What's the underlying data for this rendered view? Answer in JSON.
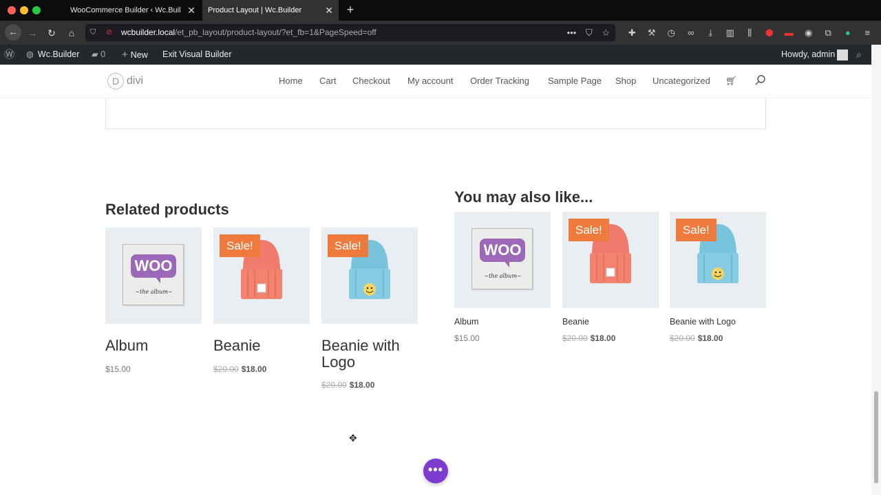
{
  "browser": {
    "tabs": [
      {
        "label": "WooCommerce Builder ‹ Wc.Builder"
      },
      {
        "label": "Product Layout | Wc.Builder"
      }
    ],
    "url_host": "wcbuilder.local",
    "url_path": "/et_pb_layout/product-layout/?et_fb=1&PageSpeed=off"
  },
  "adminbar": {
    "site_name": "Wc.Builder",
    "comments_count": "0",
    "new_label": "New",
    "exit_label": "Exit Visual Builder",
    "howdy": "Howdy, admin"
  },
  "header": {
    "logo_text": "divi",
    "logo_letter": "D",
    "menu": [
      "Home",
      "Cart",
      "Checkout",
      "My account",
      "Order Tracking",
      "Sample Page",
      "Shop",
      "Uncategorized"
    ]
  },
  "related": {
    "title": "Related products",
    "products": [
      {
        "name": "Album",
        "price": "$15.00"
      },
      {
        "name": "Beanie",
        "sale": "Sale!",
        "old_price": "$20.00",
        "price": "$18.00"
      },
      {
        "name": "Beanie with Logo",
        "sale": "Sale!",
        "old_price": "$20.00",
        "price": "$18.00"
      }
    ]
  },
  "also_like": {
    "title": "You may also like...",
    "products": [
      {
        "name": "Album",
        "price": "$15.00"
      },
      {
        "name": "Beanie",
        "sale": "Sale!",
        "old_price": "$20.00",
        "price": "$18.00"
      },
      {
        "name": "Beanie with Logo",
        "sale": "Sale!",
        "old_price": "$20.00",
        "price": "$18.00"
      }
    ]
  },
  "album_art": {
    "woo": "WOO",
    "subtitle": "~the album~"
  },
  "fab_label": "•••",
  "colors": {
    "sale": "#ee7a3e",
    "woo_purple": "#9b69b8",
    "fab": "#7e3bd0",
    "beanie_red": "#f07a6c",
    "beanie_blue": "#78c3dc"
  }
}
